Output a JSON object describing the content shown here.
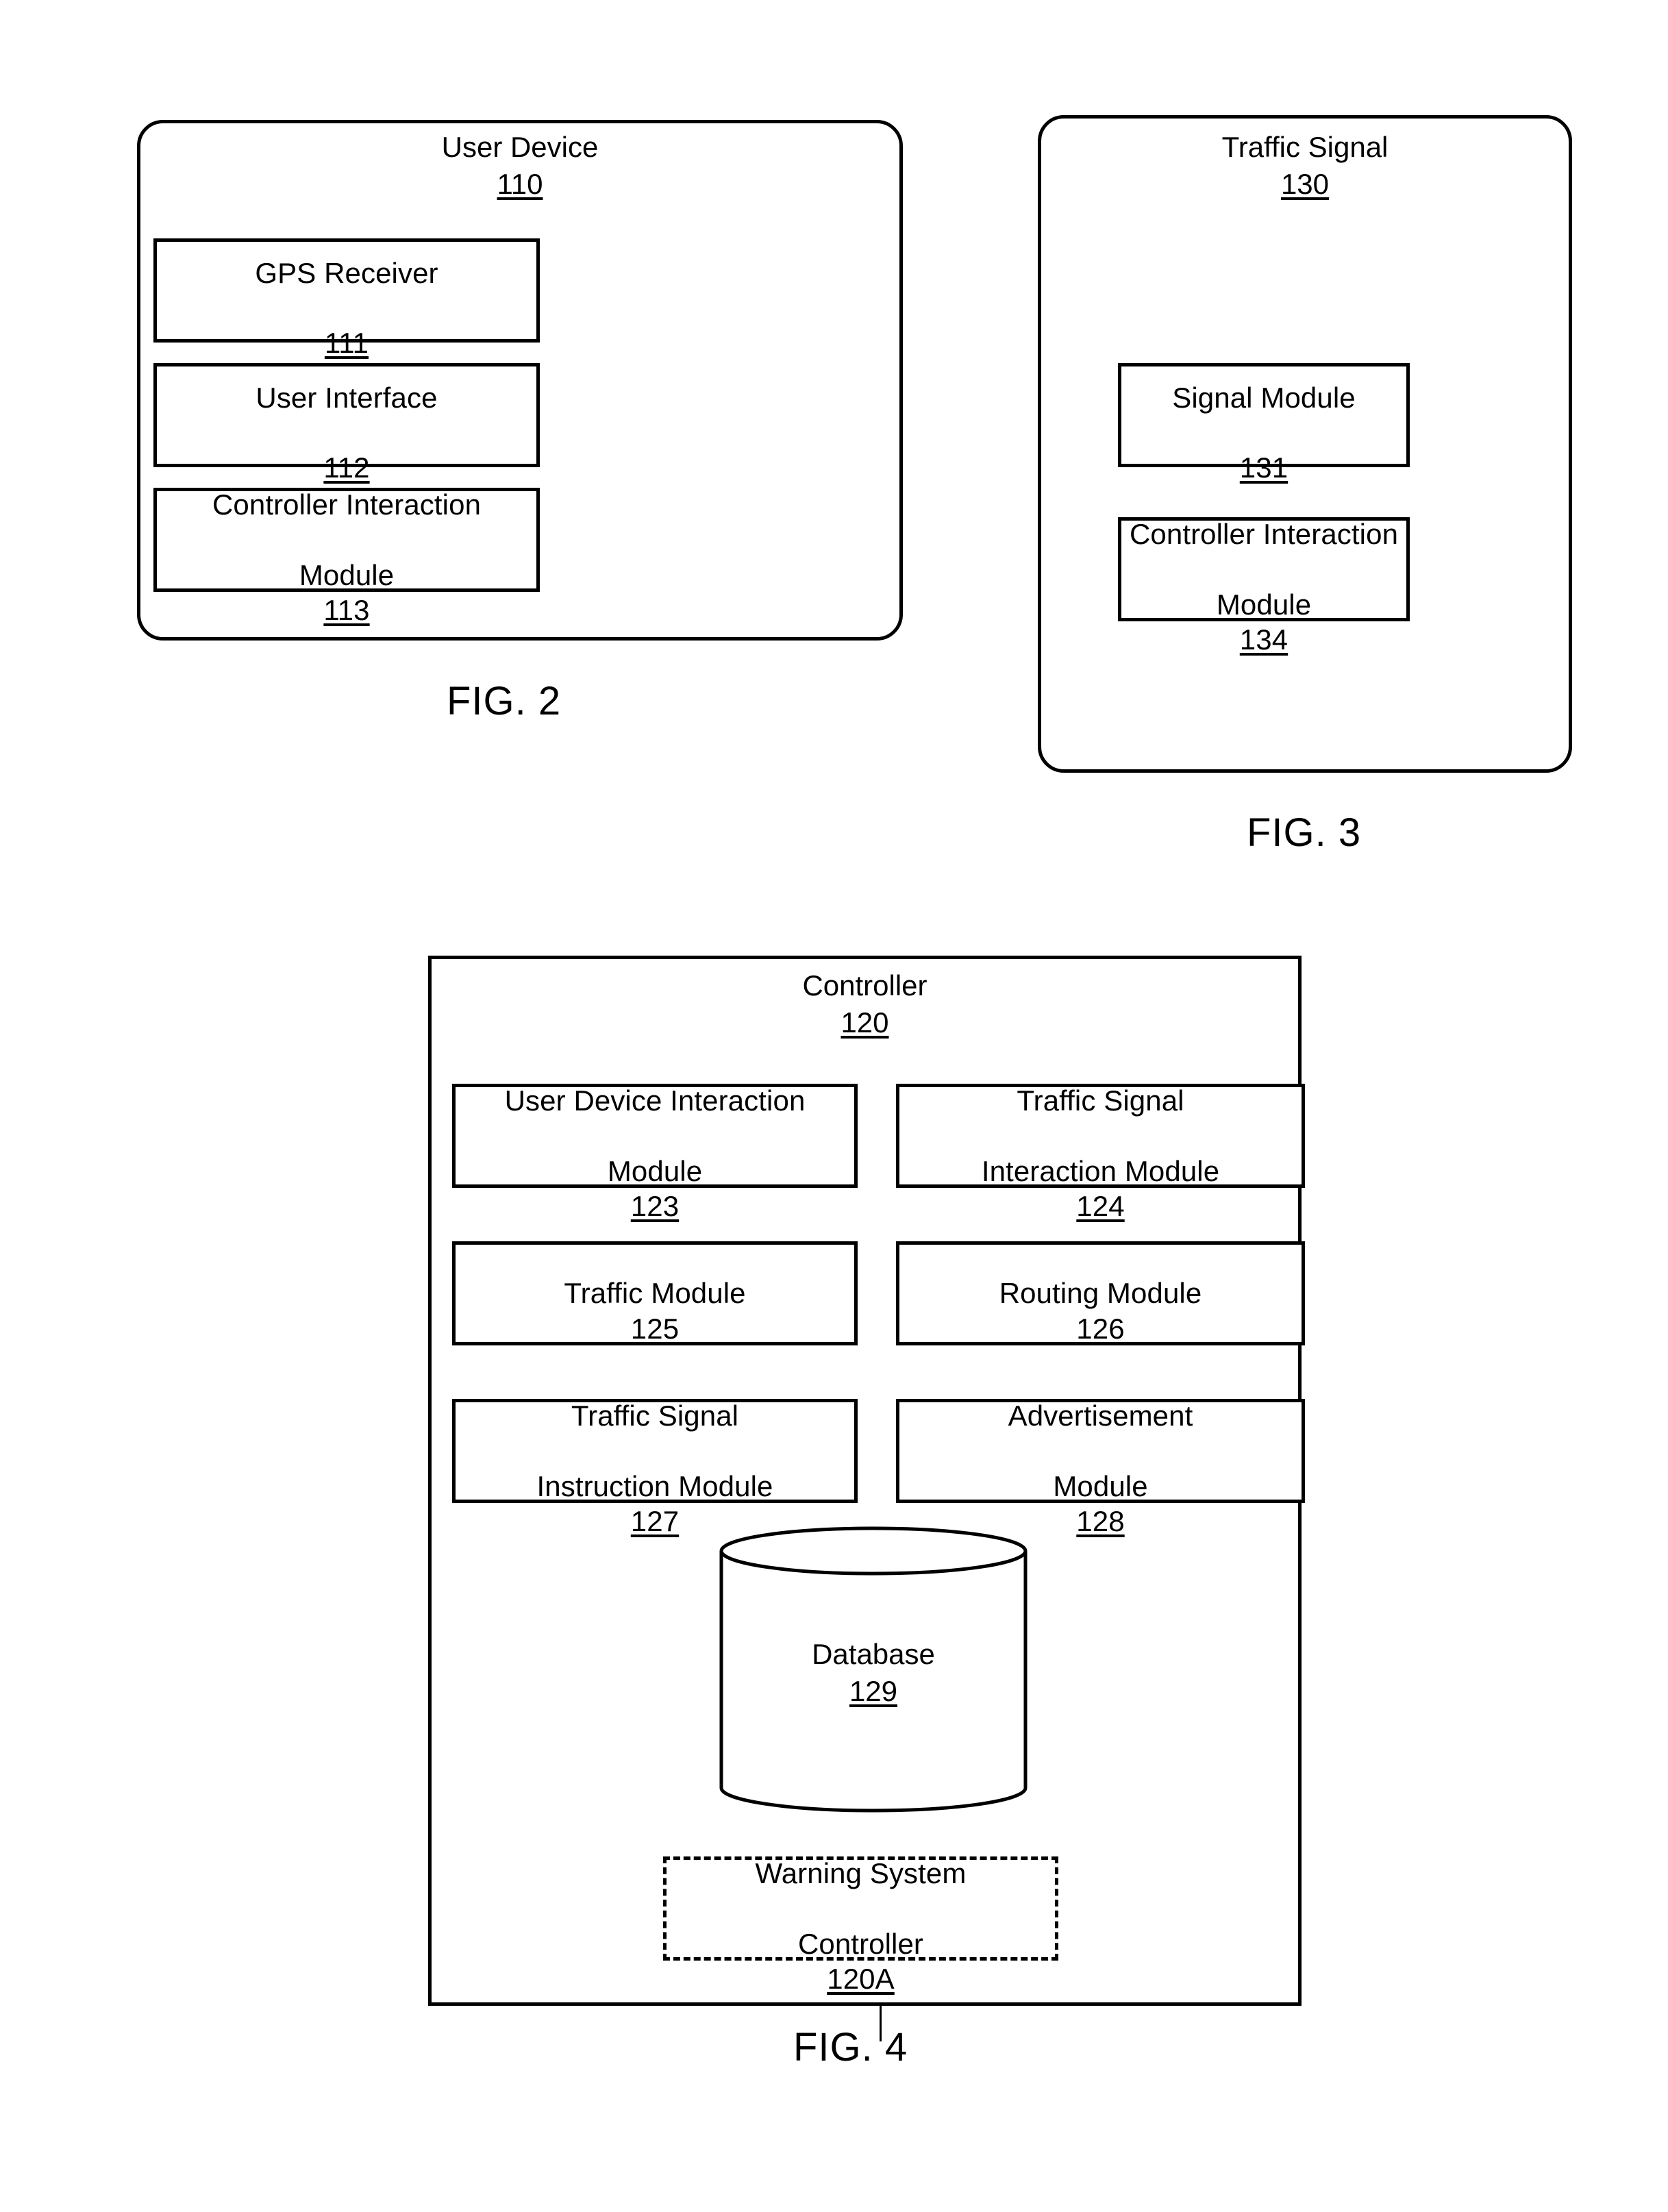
{
  "figures": {
    "fig2": {
      "caption": "FIG. 2",
      "title": "User Device",
      "ref": "110",
      "modules": [
        {
          "name": "GPS Receiver",
          "ref": "111",
          "layout": "stacked"
        },
        {
          "name": "User Interface",
          "ref": "112",
          "layout": "stacked"
        },
        {
          "name": "Controller Interaction",
          "ref": "113",
          "second_line_prefix": "Module",
          "layout": "inline"
        }
      ]
    },
    "fig3": {
      "caption": "FIG. 3",
      "title": "Traffic Signal",
      "ref": "130",
      "modules": [
        {
          "name": "Signal Module",
          "ref": "131",
          "layout": "stacked"
        },
        {
          "name": "Controller Interaction",
          "ref": "134",
          "second_line_prefix": "Module",
          "layout": "inline"
        }
      ]
    },
    "fig4": {
      "caption": "FIG. 4",
      "title": "Controller",
      "ref": "120",
      "modules": [
        {
          "line1": "User Device Interaction",
          "line2_prefix": "Module",
          "ref": "123"
        },
        {
          "line1": "Traffic Signal",
          "line2_prefix": "Interaction Module",
          "ref": "124"
        },
        {
          "line1": "",
          "line2_prefix": "Traffic Module",
          "ref": "125"
        },
        {
          "line1": "",
          "line2_prefix": "Routing Module",
          "ref": "126"
        },
        {
          "line1": "Traffic Signal",
          "line2_prefix": "Instruction Module",
          "ref": "127"
        },
        {
          "line1": "Advertisement",
          "line2_prefix": "Module",
          "ref": "128"
        }
      ],
      "database": {
        "name": "Database",
        "ref": "129",
        "shape": "cylinder"
      },
      "optional_block": {
        "line1": "Warning System",
        "line2_prefix": "Controller",
        "ref": "120A",
        "style": "dashed"
      }
    }
  },
  "colors": {
    "stroke": "#000000",
    "background": "#ffffff"
  }
}
